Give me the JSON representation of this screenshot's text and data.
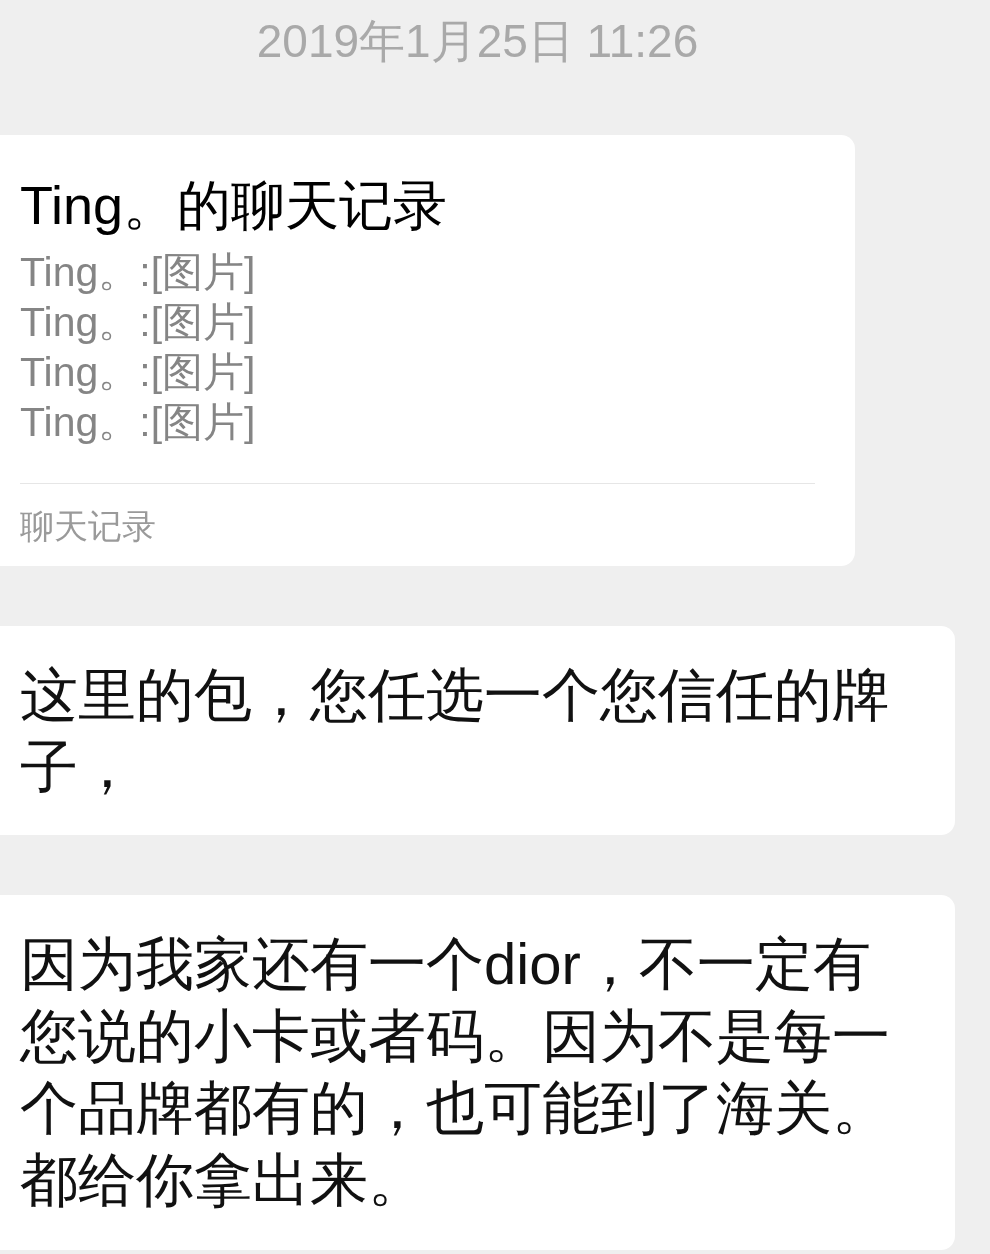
{
  "timestamp": "2019年1月25日 11:26",
  "messages": [
    {
      "kind": "chat_record",
      "title": "Ting。的聊天记录",
      "lines": [
        "Ting。:[图片]",
        "Ting。:[图片]",
        "Ting。:[图片]",
        "Ting。:[图片]"
      ],
      "footer": "聊天记录"
    },
    {
      "kind": "text",
      "text": "这里的包，您任选一个您信任的牌子，"
    },
    {
      "kind": "text",
      "text": "因为我家还有一个dior，不一定有您说的小卡或者码。因为不是每一个品牌都有的，也可能到了海关。都给你拿出来。"
    }
  ]
}
